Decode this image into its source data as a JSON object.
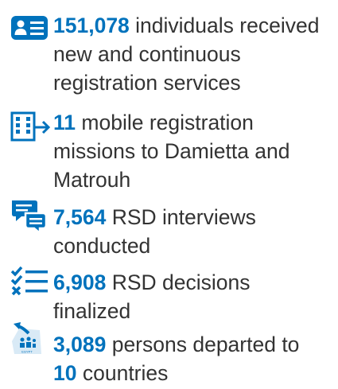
{
  "colors": {
    "accent": "#0072bc",
    "text": "#333333"
  },
  "stats": [
    {
      "icon": "registration-card-icon",
      "number": "151,078",
      "text": "individuals received new and continuous registration services"
    },
    {
      "icon": "mobile-mission-building-icon",
      "number": "11",
      "text": "mobile registration missions to Damietta and Matrouh"
    },
    {
      "icon": "interview-chat-icon",
      "number": "7,564",
      "text": "RSD interviews conducted"
    },
    {
      "icon": "decision-checklist-icon",
      "number": "6,908",
      "text": "RSD decisions finalized"
    },
    {
      "icon": "departure-map-icon",
      "number": "3,089",
      "text": "persons departed to",
      "number2": "10",
      "text2": "countries",
      "icon_label": "EGYPT"
    }
  ]
}
